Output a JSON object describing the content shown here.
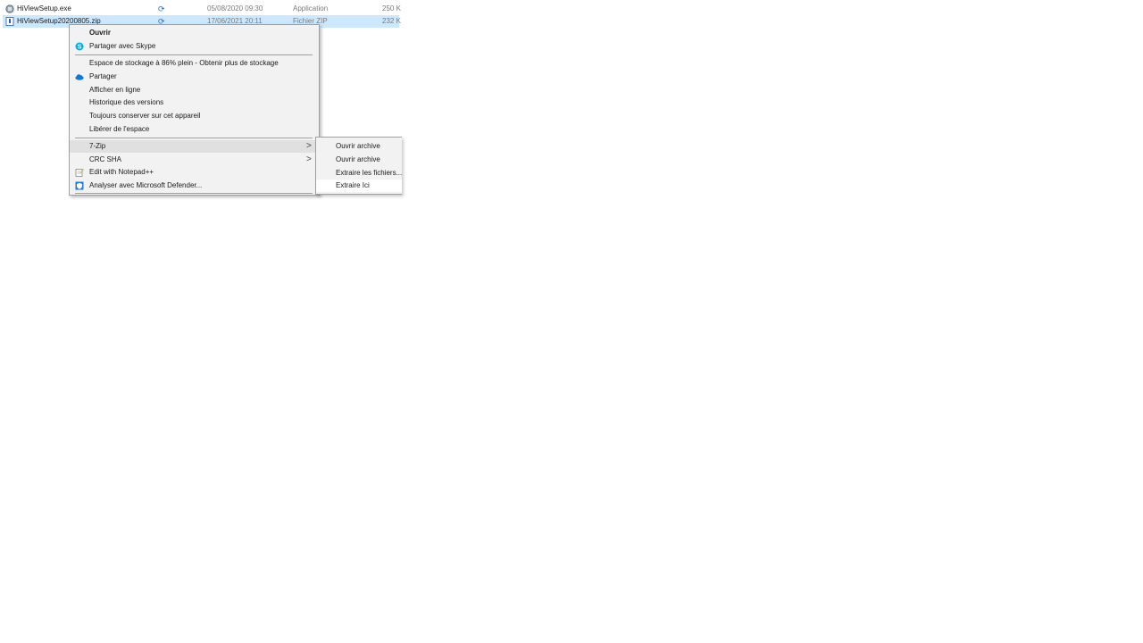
{
  "files": [
    {
      "name": "HiViewSetup.exe",
      "date": "05/08/2020 09:30",
      "type": "Application",
      "size": "250 K",
      "icon": "exe-icon",
      "sync_icon": "sync-icon",
      "selected": false
    },
    {
      "name": "HiViewSetup20200805.zip",
      "date": "17/06/2021 20:11",
      "type": "Fichier ZIP",
      "size": "232 K",
      "icon": "zip-icon",
      "sync_icon": "sync-icon",
      "selected": true
    }
  ],
  "context_menu": {
    "open": "Ouvrir",
    "share_skype": "Partager avec Skype",
    "storage": "Espace de stockage à 86% plein - Obtenir plus de stockage",
    "share": "Partager",
    "view_online": "Afficher en ligne",
    "version_history": "Historique des versions",
    "always_keep": "Toujours conserver sur cet appareil",
    "free_space": "Libérer de l'espace",
    "zip7": "7-Zip",
    "crc_sha": "CRC SHA",
    "edit_notepad": "Edit with Notepad++",
    "defender": "Analyser avec Microsoft Defender..."
  },
  "submenu_7zip": [
    "Ouvrir archive",
    "Ouvrir archive",
    "Extraire les fichiers...",
    "Extraire Ici"
  ],
  "colors": {
    "selection": "#cce8ff",
    "menu_bg": "#f2f2f2",
    "onedrive": "#0f78d4",
    "skype": "#00aff0"
  }
}
